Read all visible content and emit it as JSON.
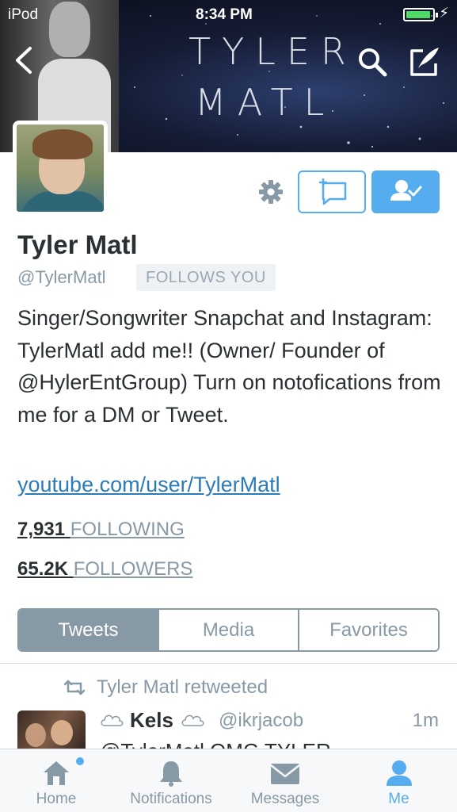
{
  "status_bar": {
    "carrier": "iPod",
    "time": "8:34 PM",
    "battery_color": "#4cd964"
  },
  "banner": {
    "brand_line1": "TYLER",
    "brand_line2": "MATL"
  },
  "header_icons": [
    "back-arrow-icon",
    "search-icon",
    "compose-tweet-icon"
  ],
  "profile": {
    "name": "Tyler Matl",
    "handle": "@TylerMatl",
    "follows_you": "FOLLOWS YOU",
    "bio": "Singer/Songwriter Snapchat and Instagram: TylerMatl add me!! (Owner/ Founder of @HylerEntGroup) Turn on notofications from me for a DM or Tweet.",
    "website": "youtube.com/user/TylerMatl",
    "following_count": "7,931",
    "following_label": "FOLLOWING",
    "followers_count": "65.2K",
    "followers_label": "FOLLOWERS"
  },
  "actions": {
    "settings_icon": "gear-icon",
    "dm_icon": "direct-message-icon",
    "following_icon": "user-following-icon",
    "accent_color": "#55acee"
  },
  "segments": {
    "items": [
      "Tweets",
      "Media",
      "Favorites"
    ],
    "active": "Tweets"
  },
  "tweet": {
    "retweet_label": "Tyler Matl retweeted",
    "author_name": "Kels",
    "author_handle": "@ikrjacob",
    "time": "1m",
    "text": "@TylerMatl OMG TYLER"
  },
  "tabbar": {
    "items": [
      {
        "label": "Home",
        "icon": "home-icon"
      },
      {
        "label": "Notifications",
        "icon": "bell-icon"
      },
      {
        "label": "Messages",
        "icon": "envelope-icon"
      },
      {
        "label": "Me",
        "icon": "person-icon"
      }
    ],
    "active": "Me"
  }
}
